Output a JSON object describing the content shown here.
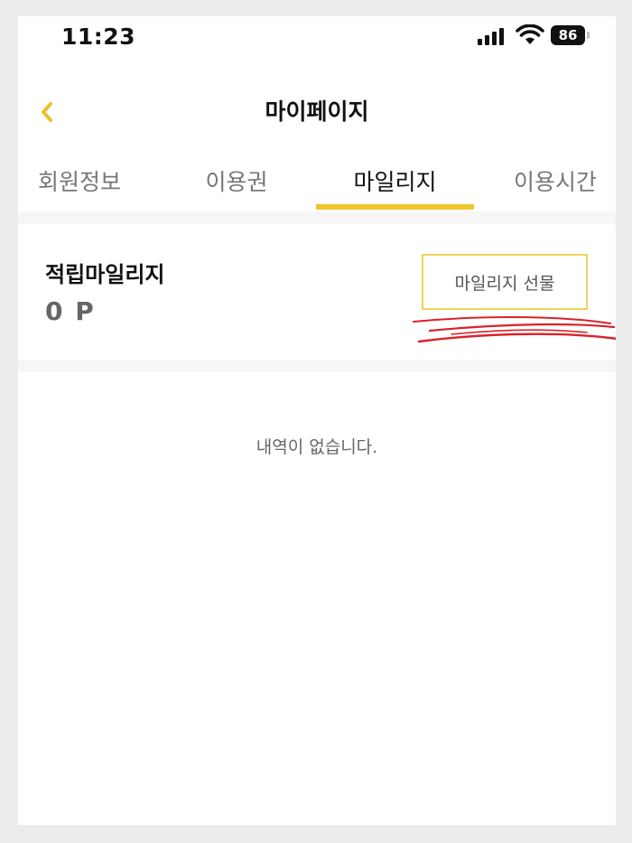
{
  "status_bar": {
    "time": "11:23",
    "battery": "86",
    "icons": [
      "signal-icon",
      "wifi-icon",
      "battery-icon"
    ]
  },
  "header": {
    "back_icon": "chevron-left-icon",
    "title": "마이페이지"
  },
  "tabs": [
    {
      "label": "회원정보",
      "active": false
    },
    {
      "label": "이용권",
      "active": false
    },
    {
      "label": "마일리지",
      "active": true
    },
    {
      "label": "이용시간",
      "active": false
    }
  ],
  "mileage": {
    "label": "적립마일리지",
    "value": "0 P",
    "gift_button_label": "마일리지 선물"
  },
  "history": {
    "empty_message": "내역이 없습니다."
  },
  "colors": {
    "accent": "#efc52a",
    "button_border": "#efd25a",
    "annotation": "#d8232a"
  }
}
